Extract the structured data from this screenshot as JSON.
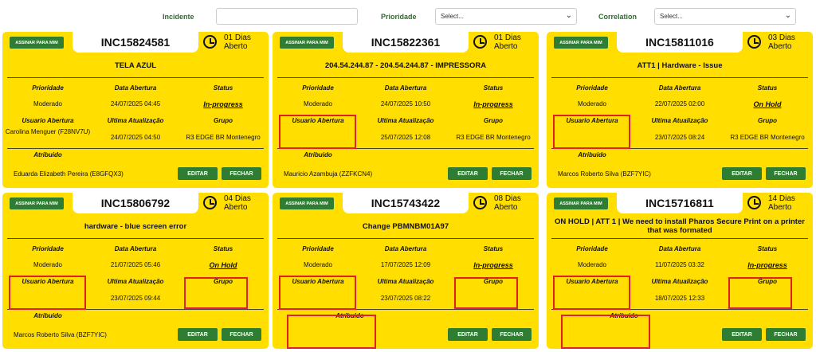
{
  "filters": {
    "incidente_label": "Incidente",
    "incidente_value": "",
    "prioridade_label": "Prioridade",
    "prioridade_value": "Select...",
    "correlation_label": "Correlation",
    "correlation_value": "Select..."
  },
  "labels": {
    "assign": "ASSINAR PARA MIM",
    "prioridade": "Prioridade",
    "data_abertura": "Data Abertura",
    "status": "Status",
    "usuario": "Usuario Abertura",
    "ultima": "Ultima Atualização",
    "grupo": "Grupo",
    "atribuido": "Atribuido",
    "editar": "EDITAR",
    "fechar": "FECHAR"
  },
  "highlight_color": "#e0202a",
  "cards": [
    {
      "id": "INC15824581",
      "days": "01 Dias Aberto",
      "title": "TELA AZUL",
      "prioridade": "Moderado",
      "data_abertura": "24/07/2025 04:45",
      "status": "In-progress",
      "usuario": "Carolina Menguer (F28NV7U)",
      "ultima": "24/07/2025 04:50",
      "grupo": "R3 EDGE BR Montenegro",
      "atribuido": "Eduarda Elizabeth Pereira (E8GFQX3)"
    },
    {
      "id": "INC15822361",
      "days": "01 Dias Aberto",
      "title": "204.54.244.87 - 204.54.244.87 - IMPRESSORA",
      "prioridade": "Moderado",
      "data_abertura": "24/07/2025 10:50",
      "status": "In-progress",
      "usuario": "",
      "ultima": "25/07/2025 12:08",
      "grupo": "R3 EDGE BR Montenegro",
      "atribuido": "Mauricio Azambuja (ZZFKCN4)"
    },
    {
      "id": "INC15811016",
      "days": "03 Dias Aberto",
      "title": "ATT1 | Hardware - Issue",
      "prioridade": "Moderado",
      "data_abertura": "22/07/2025 02:00",
      "status": "On Hold",
      "usuario": "",
      "ultima": "23/07/2025 08:24",
      "grupo": "R3 EDGE BR Montenegro",
      "atribuido": "Marcos Roberto Silva (BZF7YIC)"
    },
    {
      "id": "INC15806792",
      "days": "04 Dias Aberto",
      "title": "hardware - blue screen error",
      "prioridade": "Moderado",
      "data_abertura": "21/07/2025 05:46",
      "status": "On Hold",
      "usuario": "",
      "ultima": "23/07/2025 09:44",
      "grupo": "",
      "atribuido": "Marcos Roberto Silva (BZF7YIC)"
    },
    {
      "id": "INC15743422",
      "days": "08 Dias Aberto",
      "title": "Change PBMNBM01A97",
      "prioridade": "Moderado",
      "data_abertura": "17/07/2025 12:09",
      "status": "In-progress",
      "usuario": "",
      "ultima": "23/07/2025 08:22",
      "grupo": "",
      "atribuido": ""
    },
    {
      "id": "INC15716811",
      "days": "14 Dias Aberto",
      "title": "ON HOLD | ATT 1 | We need to install Pharos Secure Print on a printer that was formated",
      "prioridade": "Moderado",
      "data_abertura": "11/07/2025 03:32",
      "status": "In-progress",
      "usuario": "",
      "ultima": "18/07/2025 12:33",
      "grupo": "",
      "atribuido": ""
    }
  ]
}
